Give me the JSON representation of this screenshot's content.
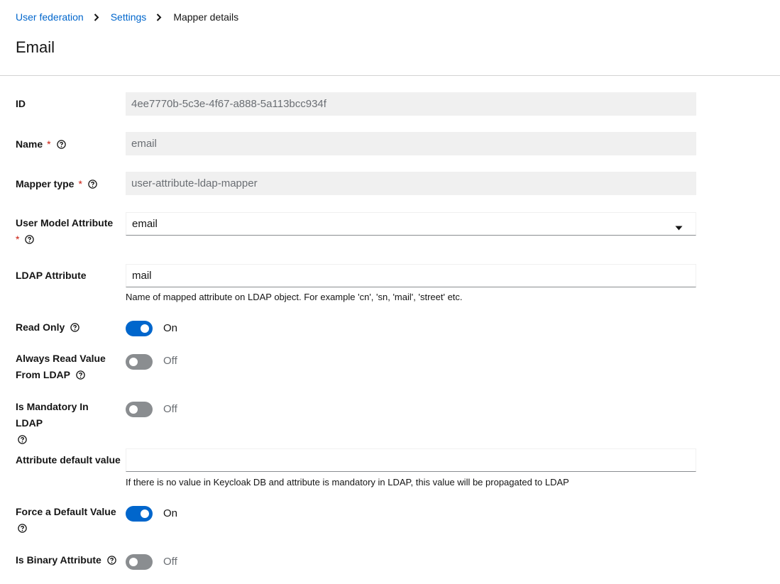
{
  "breadcrumb": {
    "items": [
      "User federation",
      "Settings"
    ],
    "current": "Mapper details"
  },
  "page_title": "Email",
  "form": {
    "id": {
      "label": "ID",
      "value": "4ee7770b-5c3e-4f67-a888-5a113bcc934f"
    },
    "name": {
      "label": "Name",
      "required": "*",
      "value": "email"
    },
    "mapper_type": {
      "label": "Mapper type",
      "required": "*",
      "value": "user-attribute-ldap-mapper"
    },
    "user_model_attribute": {
      "label": "User Model Attribute",
      "required": "*",
      "value": "email"
    },
    "ldap_attribute": {
      "label": "LDAP Attribute",
      "value": "mail",
      "helper": "Name of mapped attribute on LDAP object. For example 'cn', 'sn, 'mail', 'street' etc."
    },
    "read_only": {
      "label": "Read Only",
      "state": "On"
    },
    "always_read_value": {
      "label": "Always Read Value From LDAP",
      "state": "Off"
    },
    "is_mandatory": {
      "label": "Is Mandatory In LDAP",
      "state": "Off"
    },
    "attribute_default_value": {
      "label": "Attribute default value",
      "value": "",
      "helper": "If there is no value in Keycloak DB and attribute is mandatory in LDAP, this value will be propagated to LDAP"
    },
    "force_default_value": {
      "label": "Force a Default Value",
      "state": "On"
    },
    "is_binary_attribute": {
      "label": "Is Binary Attribute",
      "state": "Off"
    }
  },
  "colors": {
    "link": "#0066cc",
    "toggle_on": "#0066cc",
    "toggle_off": "#8a8d90",
    "required": "#c9190b",
    "readonly_bg": "#f0f0f0"
  },
  "icons": {
    "breadcrumb_separator": "chevron-right-icon",
    "help": "help-circle-icon",
    "dropdown": "caret-down-icon"
  }
}
